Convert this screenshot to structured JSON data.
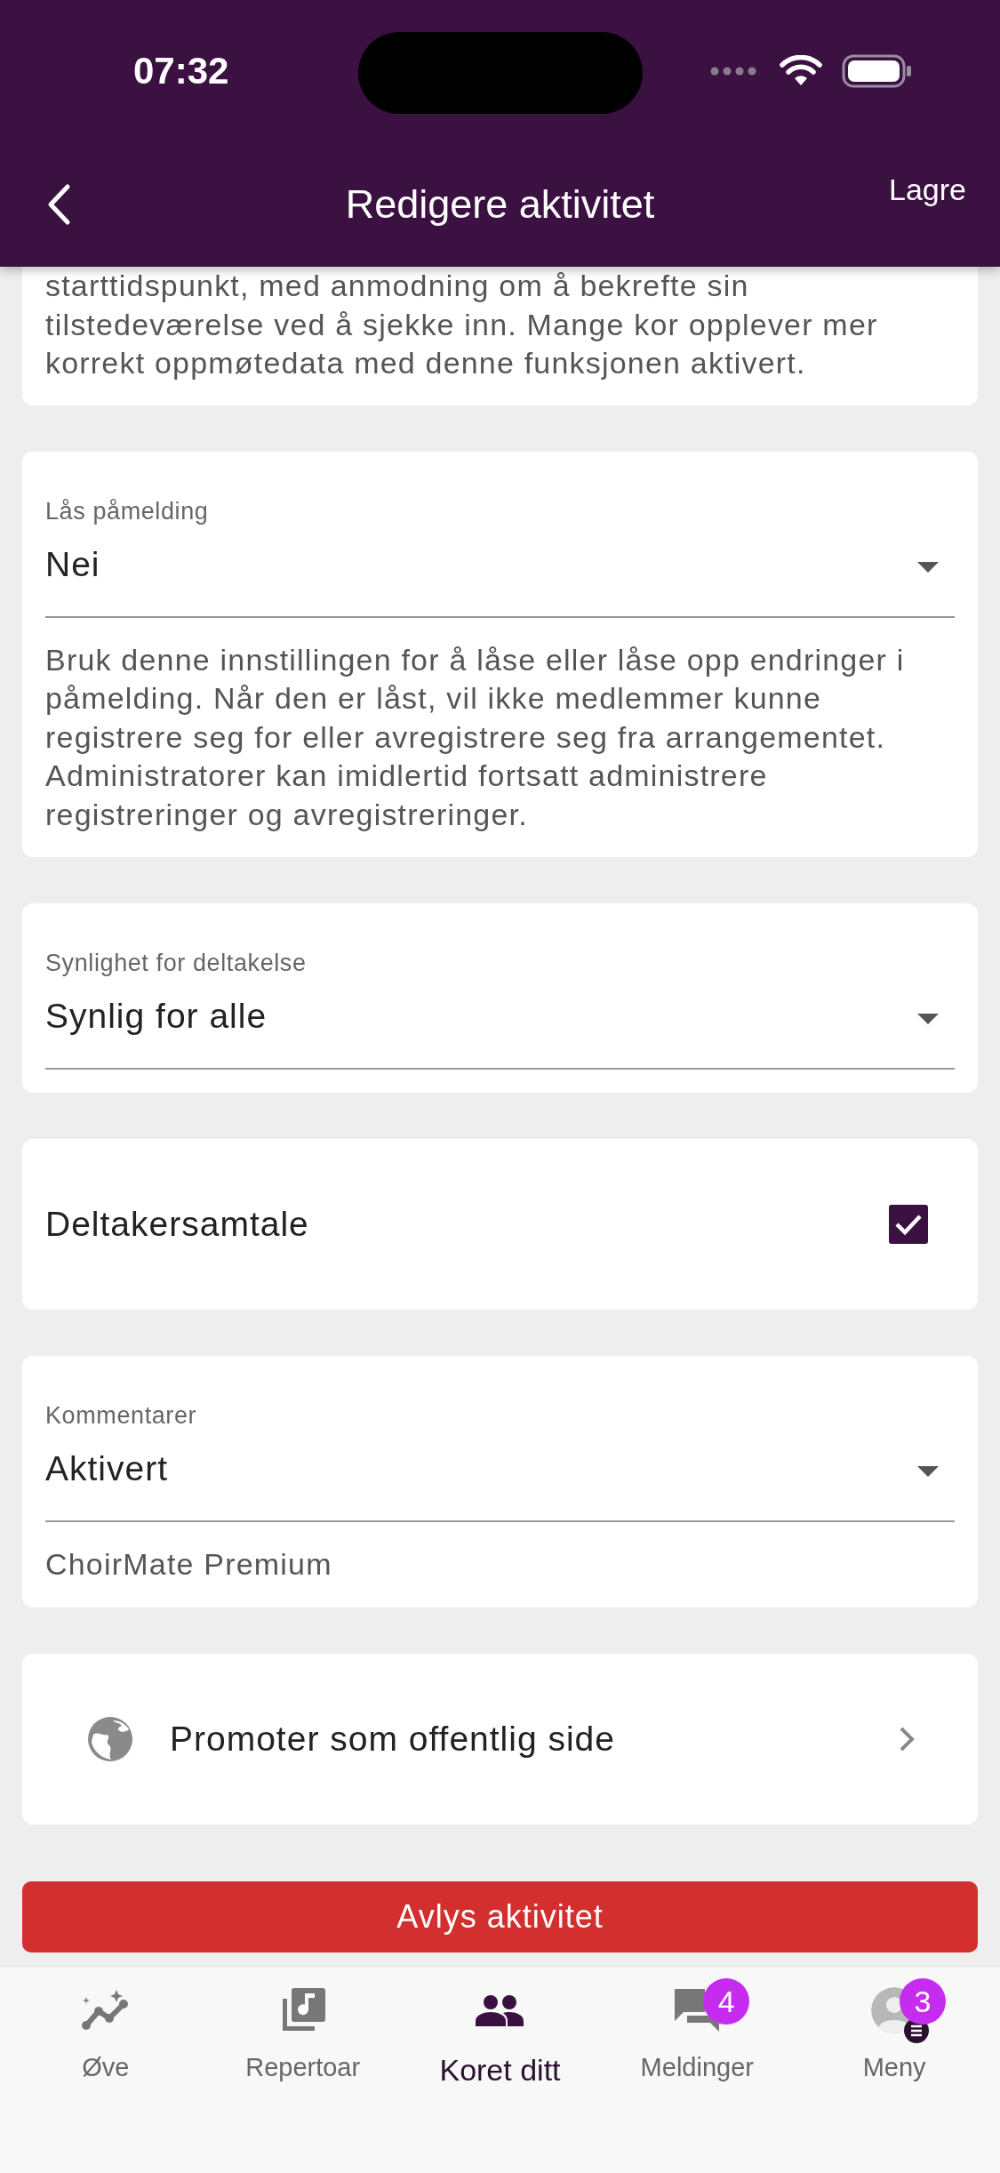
{
  "status_bar": {
    "time": "07:32"
  },
  "header": {
    "title": "Redigere aktivitet",
    "action": "Lagre"
  },
  "intro_card": {
    "text": "starttidspunkt, med anmodning om å bekrefte sin tilstedeværelse ved å sjekke inn. Mange kor opplever mer korrekt oppmøtedata med denne funksjonen aktivert."
  },
  "sections": [
    {
      "kind": "select",
      "label": "Lås påmelding",
      "value": "Nei",
      "helper": "Bruk denne innstillingen for å låse eller låse opp endringer i påmelding. Når den er låst, vil ikke medlemmer kunne registrere seg for eller avregistrere seg fra arrangementet. Administratorer kan imidlertid fortsatt administrere registreringer og avregistreringer."
    },
    {
      "kind": "select",
      "label": "Synlighet for deltakelse",
      "value": "Synlig for alle"
    },
    {
      "kind": "checkbox",
      "label": "Deltakersamtale",
      "checked": true
    },
    {
      "kind": "select",
      "label": "Kommentarer",
      "value": "Aktivert",
      "helper": "ChoirMate Premium"
    },
    {
      "kind": "link",
      "label": "Promoter som offentlig side"
    }
  ],
  "cancel_button": "Avlys aktivitet",
  "nav": [
    {
      "label": "Øve",
      "selected": false
    },
    {
      "label": "Repertoar",
      "selected": false
    },
    {
      "label": "Koret ditt",
      "selected": true
    },
    {
      "label": "Meldinger",
      "selected": false,
      "badge": "4"
    },
    {
      "label": "Meny",
      "selected": false,
      "badge": "3"
    }
  ]
}
